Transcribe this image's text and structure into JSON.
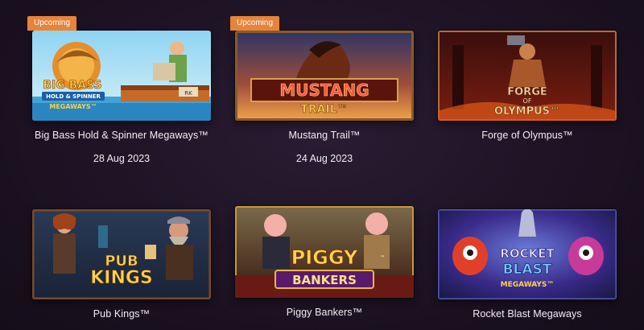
{
  "games": [
    {
      "badge": "Upcoming",
      "title": "Big Bass Hold & Spinner Megaways™",
      "date": "28 Aug 2023",
      "logo": [
        "BIG BASS",
        "HOLD & SPINNER",
        "MEGAWAYS™"
      ],
      "boat_label": "RK"
    },
    {
      "badge": "Upcoming",
      "title": "Mustang Trail™",
      "date": "24 Aug 2023",
      "logo": [
        "MUSTANG",
        "TRAIL™"
      ]
    },
    {
      "title": "Forge of Olympus™",
      "logo": [
        "FORGE",
        "OF",
        "OLYMPUS™"
      ]
    },
    {
      "title": "Pub Kings™",
      "logo": [
        "PUB",
        "KINGS"
      ]
    },
    {
      "title": "Piggy Bankers™",
      "logo": [
        "PIGGY",
        "BANKERS",
        "™"
      ]
    },
    {
      "title": "Rocket Blast Megaways",
      "logo": [
        "ROCKET",
        "BLAST",
        "MEGAWAYS™"
      ]
    }
  ]
}
